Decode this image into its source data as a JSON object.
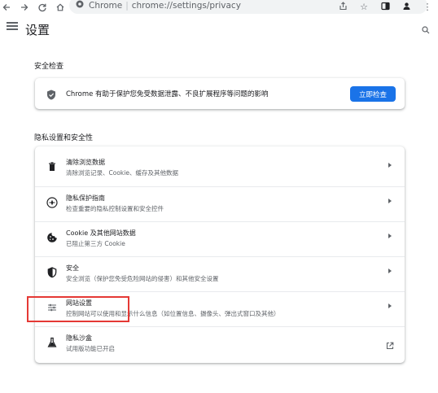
{
  "browser": {
    "site_name": "Chrome",
    "url": "chrome://settings/privacy"
  },
  "header": {
    "title": "设置"
  },
  "safety_check": {
    "section_title": "安全检查",
    "text": "Chrome 有助于保护您免受数据泄露、不良扩展程序等问题的影响",
    "button_label": "立即检查"
  },
  "privacy": {
    "section_title": "隐私设置和安全性",
    "items": [
      {
        "title": "清除浏览数据",
        "subtitle": "清除浏览记录、Cookie、缓存及其他数据",
        "icon": "trash-icon"
      },
      {
        "title": "隐私保护指南",
        "subtitle": "检查重要的隐私控制设置和安全控件",
        "icon": "compass-icon"
      },
      {
        "title": "Cookie 及其他网站数据",
        "subtitle": "已阻止第三方 Cookie",
        "icon": "cookie-icon"
      },
      {
        "title": "安全",
        "subtitle": "安全浏览（保护您免受危险网站的侵害）和其他安全设置",
        "icon": "shield-icon"
      },
      {
        "title": "网站设置",
        "subtitle": "控制网站可以使用和显示什么信息（如位置信息、摄像头、弹出式窗口及其他）",
        "icon": "tune-icon"
      },
      {
        "title": "隐私沙盒",
        "subtitle": "试用版功能已开启",
        "icon": "flask-icon"
      }
    ]
  },
  "colors": {
    "accent": "#1a73e8",
    "highlight": "#e53935"
  }
}
